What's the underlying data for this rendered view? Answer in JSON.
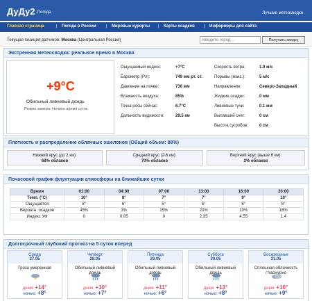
{
  "header": {
    "logo": "ДуДу2",
    "logo_sub": ".Погода",
    "slogan": "Лучшие метеосводки"
  },
  "nav": {
    "items": [
      "Главная страница",
      "Погода в России",
      "Мировые курорты",
      "Карты осадков",
      "Информеры для сайта"
    ],
    "separator": "|"
  },
  "location": {
    "label": "Текущая позиция датчиков:",
    "city": "Москва",
    "region": "(Центральная Россия)",
    "search_placeholder": "Введите город...",
    "button": "Получить сводку"
  },
  "current": {
    "title": "Экстренная метеосводка: реальное время в Москва",
    "temp": "+9°C",
    "condition": "Обильный ливневый дождь",
    "mode": "Режим замера: Ночное время суток",
    "params_left": [
      {
        "label": "Ощущаемый индекс:",
        "value": "+7°C"
      },
      {
        "label": "Барометр (Рл):",
        "value": "749 мм рт. ст."
      },
      {
        "label": "Давление на почве:",
        "value": "736 мм"
      },
      {
        "label": "Влажность воздуха:",
        "value": "85%"
      },
      {
        "label": "Точка росы сейчас:",
        "value": "6.7°C"
      },
      {
        "label": "Дальность видимости:",
        "value": "29.5 км"
      }
    ],
    "params_right": [
      {
        "label": "Скорость ветра:",
        "value": "1.9 м/с"
      },
      {
        "label": "Порывы (макс.):",
        "value": "5 м/с"
      },
      {
        "label": "Направление:",
        "value": "Северо-Западный"
      },
      {
        "label": "Жидкие осадки:",
        "value": "0 мм"
      },
      {
        "label": "Ливневые тучи:",
        "value": "0.1 мм"
      },
      {
        "label": "Выпавший снег:",
        "value": "0 см"
      },
      {
        "label": "Высота сугробов:",
        "value": "0 см"
      }
    ]
  },
  "clouds": {
    "title": "Плотность и распределение облачных эшелонов (Общий объем: 88%)",
    "layers": [
      {
        "name": "Нижний ярус (до 2 км):",
        "value": "68% облаков"
      },
      {
        "name": "Средний ярус (2-6 км):",
        "value": "70% облаков"
      },
      {
        "name": "Верхний ярус (выше 6 км):",
        "value": "2% облаков"
      }
    ]
  },
  "hourly": {
    "title": "Почасовой график флуктуации атмосферы на ближайшие сутки",
    "header": [
      "Время",
      "01:00",
      "04:00",
      "07:00",
      "13:00",
      "16:00",
      "20:00"
    ],
    "rows": [
      {
        "label": "Темп. (°C)",
        "bold": true,
        "values": [
          "10°",
          "8°",
          "7°",
          "7°",
          "9°",
          "10°"
        ]
      },
      {
        "label": "Ощущается",
        "bold": false,
        "values": [
          "8°",
          "6°",
          "5°",
          "5°",
          "6°",
          "8°"
        ]
      },
      {
        "label": "Вероятн. осадков",
        "bold": false,
        "values": [
          "45%",
          "3%",
          "15%",
          "20%",
          "10%",
          "18%"
        ]
      },
      {
        "label": "Индекс УФ",
        "bold": false,
        "values": [
          "0",
          "0.05",
          "0",
          "2.35",
          "4.55",
          "1.4"
        ]
      }
    ]
  },
  "forecast": {
    "title": "Долгосрочный глубокий прогноз на 5 суток вперед",
    "day_label": "днем:",
    "night_label": "ночью:",
    "days": [
      {
        "name": "Среда",
        "date": "27.05",
        "cond1": "Гроза умеренная",
        "cond2": "",
        "hi": "+14°",
        "lo": "+8°",
        "icon": "thunder-icon"
      },
      {
        "name": "Четверг",
        "date": "28.05",
        "cond1": "Обильный ливневый",
        "cond2": "дождь",
        "hi": "+10°",
        "lo": "+7°",
        "icon": "heavy-rain-icon"
      },
      {
        "name": "Пятница",
        "date": "29.05",
        "cond1": "Обильный ливневый",
        "cond2": "дождь",
        "hi": "+11°",
        "lo": "+6°",
        "icon": "heavy-rain-icon"
      },
      {
        "name": "Суббота",
        "date": "30.05",
        "cond1": "Обильный ливневый",
        "cond2": "дождь",
        "hi": "+13°",
        "lo": "+8°",
        "icon": "heavy-rain-icon"
      },
      {
        "name": "Воскресенье",
        "date": "31.05",
        "cond1": "Сплошная облачность",
        "cond2": "/ пасмурно",
        "hi": "+16°",
        "lo": "+9°",
        "icon": "overcast-icon"
      }
    ]
  },
  "colors": {
    "brand": "#2a5aa8",
    "nav": "#1d4d9c",
    "active_nav": "#ffd23a",
    "temp": "#ff3300",
    "day_temp": "#e0445e"
  }
}
